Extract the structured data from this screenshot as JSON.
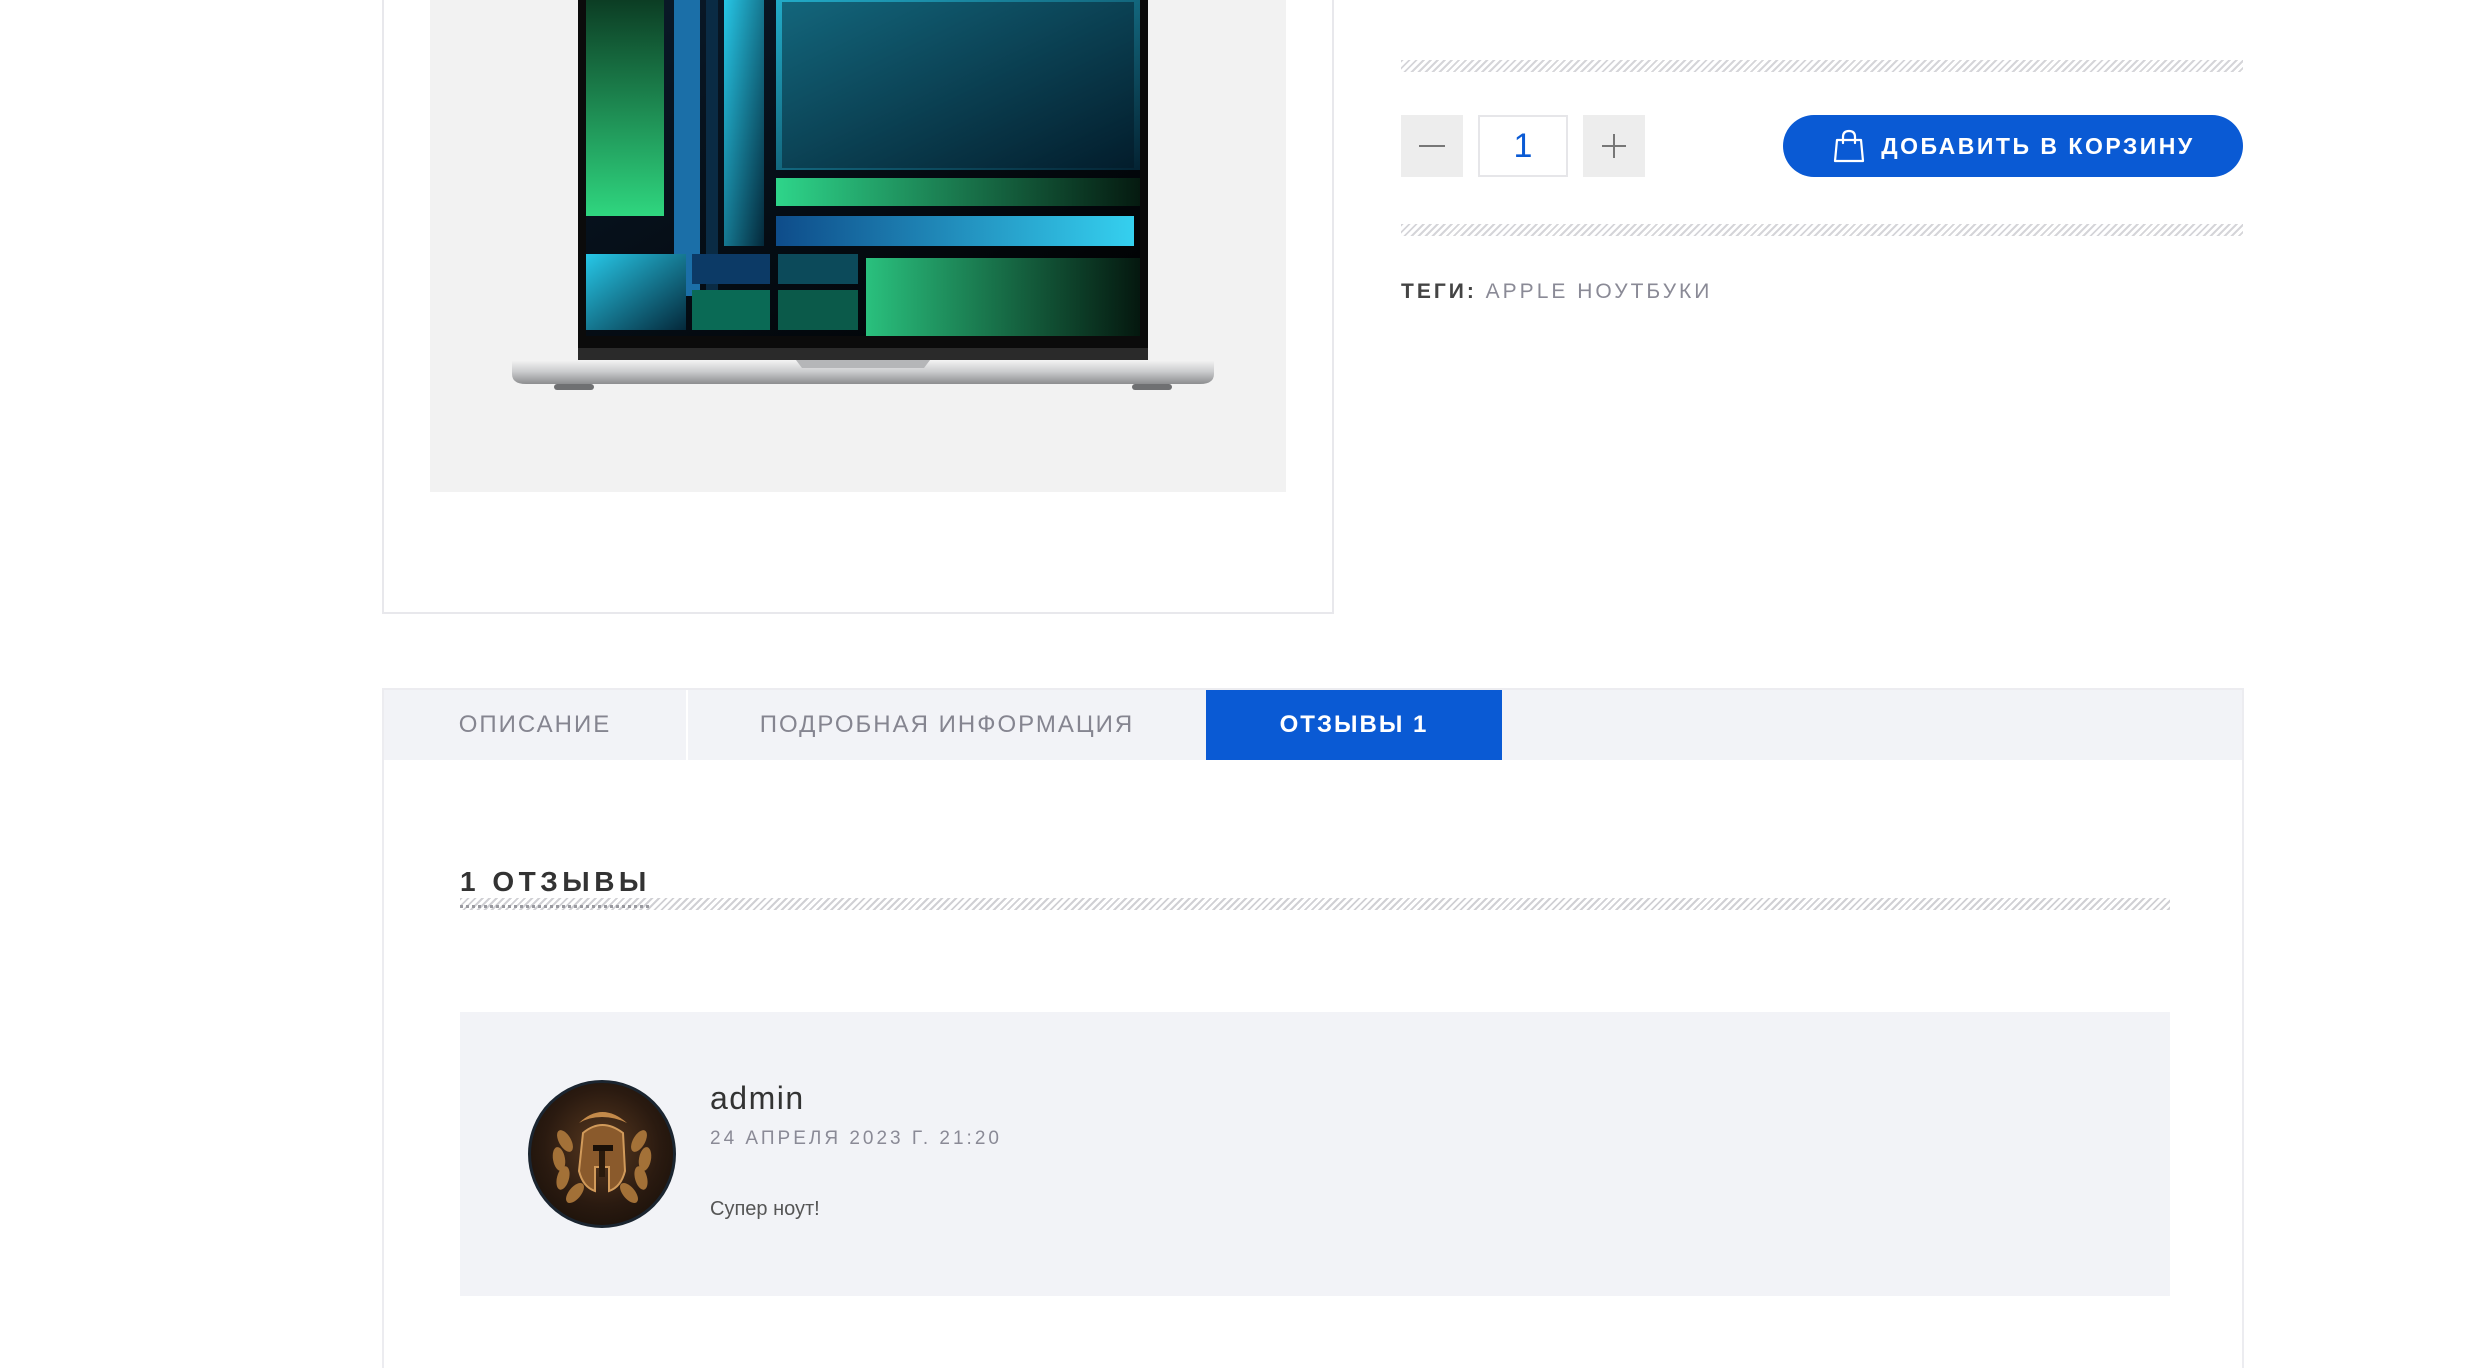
{
  "product": {
    "image_alt": "MacBook Pro",
    "quantity": "1",
    "add_to_cart_label": "ДОБАВИТЬ В КОРЗИНУ",
    "tags_label": "ТЕГИ:",
    "tag": "APPLE НОУТБУКИ"
  },
  "tabs": [
    {
      "label": "ОПИСАНИЕ",
      "active": false
    },
    {
      "label": "ПОДРОБНАЯ ИНФОРМАЦИЯ",
      "active": false
    },
    {
      "label": "ОТЗЫВЫ 1",
      "active": true
    }
  ],
  "reviews": {
    "heading": "1 ОТЗЫВЫ",
    "items": [
      {
        "author": "admin",
        "date": "24 АПРЕЛЯ 2023 Г. 21:20",
        "text": "Супер ноут!"
      }
    ]
  },
  "colors": {
    "accent": "#0a5ad4",
    "tab_bar": "#f2f3f7",
    "review_bg": "#f2f3f7"
  },
  "icons": {
    "cart": "shopping-bag-icon",
    "minus": "minus-icon",
    "plus": "plus-icon"
  }
}
